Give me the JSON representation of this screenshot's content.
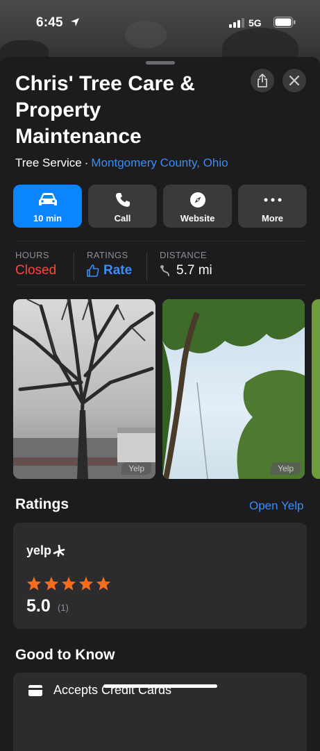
{
  "status_bar": {
    "time": "6:45",
    "network": "5G"
  },
  "place": {
    "title": "Chris' Tree Care & Property Maintenance",
    "category": "Tree Service",
    "separator": "·",
    "location": "Montgomery County, Ohio"
  },
  "actions": [
    {
      "label": "10 min",
      "icon": "car-icon"
    },
    {
      "label": "Call",
      "icon": "phone-icon"
    },
    {
      "label": "Website",
      "icon": "compass-icon"
    },
    {
      "label": "More",
      "icon": "ellipsis-icon"
    }
  ],
  "info": {
    "hours_label": "HOURS",
    "hours_value": "Closed",
    "ratings_label": "RATINGS",
    "ratings_value": "Rate",
    "distance_label": "DISTANCE",
    "distance_value": "5.7 mi"
  },
  "photos": {
    "source_tag": "Yelp"
  },
  "ratings": {
    "section_title": "Ratings",
    "open_link": "Open Yelp",
    "provider": "yelp",
    "stars": 5,
    "score": "5.0",
    "count": "(1)"
  },
  "good_to_know": {
    "section_title": "Good to Know",
    "items": [
      "Accepts Credit Cards"
    ]
  },
  "colors": {
    "accent": "#0a84ff",
    "closed": "#ff453a",
    "link": "#3a8ef6",
    "star": "#f86d1b"
  }
}
